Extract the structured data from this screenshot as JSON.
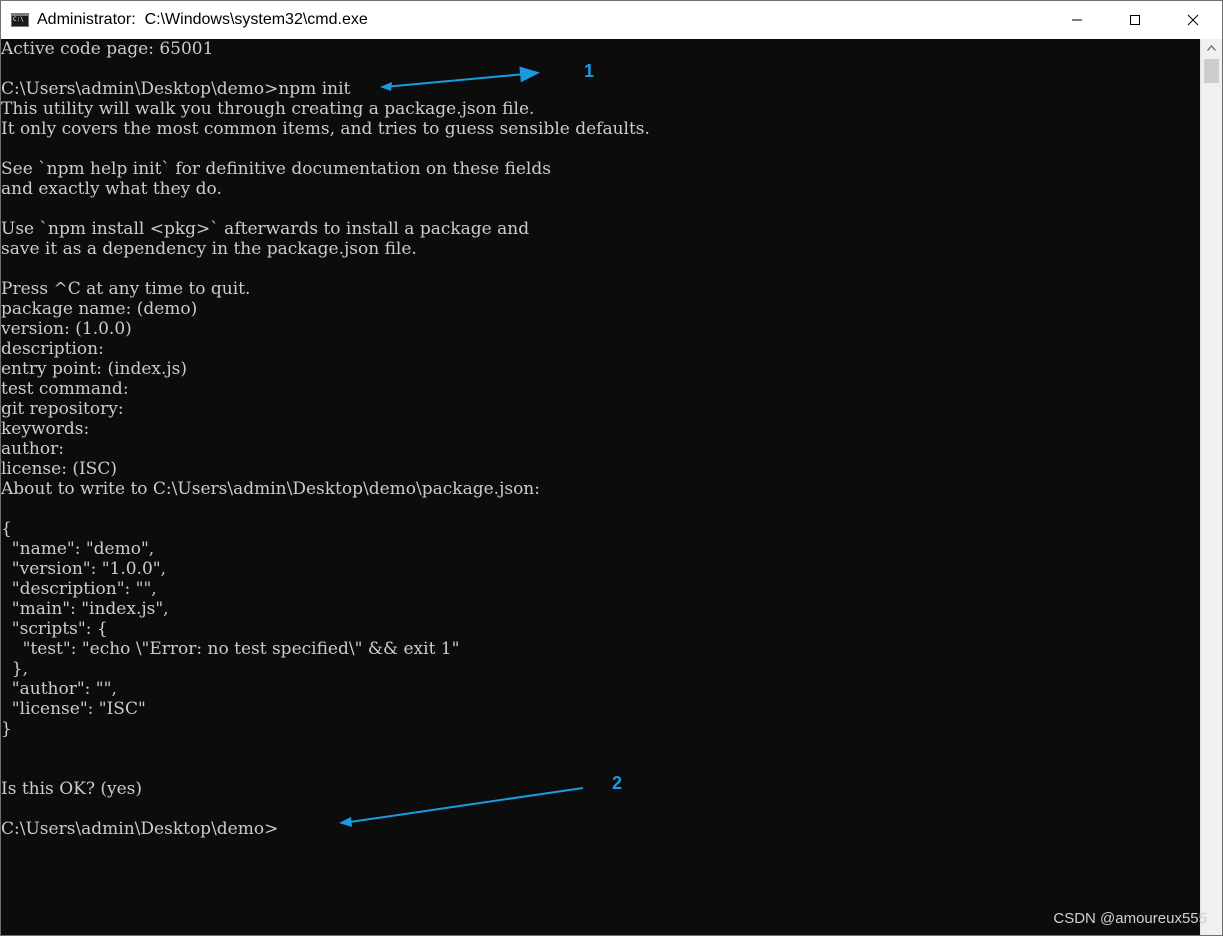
{
  "window": {
    "title": "Administrator:  C:\\Windows\\system32\\cmd.exe",
    "icon": "cmd-icon",
    "buttons": {
      "minimize": "minimize-icon",
      "maximize": "maximize-icon",
      "close": "close-icon"
    }
  },
  "console": {
    "lines": [
      "Active code page: 65001",
      "",
      "C:\\Users\\admin\\Desktop\\demo>npm init",
      "This utility will walk you through creating a package.json file.",
      "It only covers the most common items, and tries to guess sensible defaults.",
      "",
      "See `npm help init` for definitive documentation on these fields",
      "and exactly what they do.",
      "",
      "Use `npm install <pkg>` afterwards to install a package and",
      "save it as a dependency in the package.json file.",
      "",
      "Press ^C at any time to quit.",
      "package name: (demo)",
      "version: (1.0.0)",
      "description:",
      "entry point: (index.js)",
      "test command:",
      "git repository:",
      "keywords:",
      "author:",
      "license: (ISC)",
      "About to write to C:\\Users\\admin\\Desktop\\demo\\package.json:",
      "",
      "{",
      "  \"name\": \"demo\",",
      "  \"version\": \"1.0.0\",",
      "  \"description\": \"\",",
      "  \"main\": \"index.js\",",
      "  \"scripts\": {",
      "    \"test\": \"echo \\\"Error: no test specified\\\" && exit 1\"",
      "  },",
      "  \"author\": \"\",",
      "  \"license\": \"ISC\"",
      "}",
      "",
      "",
      "Is this OK? (yes)",
      "",
      "C:\\Users\\admin\\Desktop\\demo>"
    ]
  },
  "annotations": {
    "marker_1": "1",
    "marker_2": "2",
    "color": "#1a9be0"
  },
  "watermark": "CSDN @amoureux555",
  "colors": {
    "console_bg": "#0c0c0c",
    "console_text": "#cccccc",
    "titlebar_bg": "#ffffff"
  }
}
